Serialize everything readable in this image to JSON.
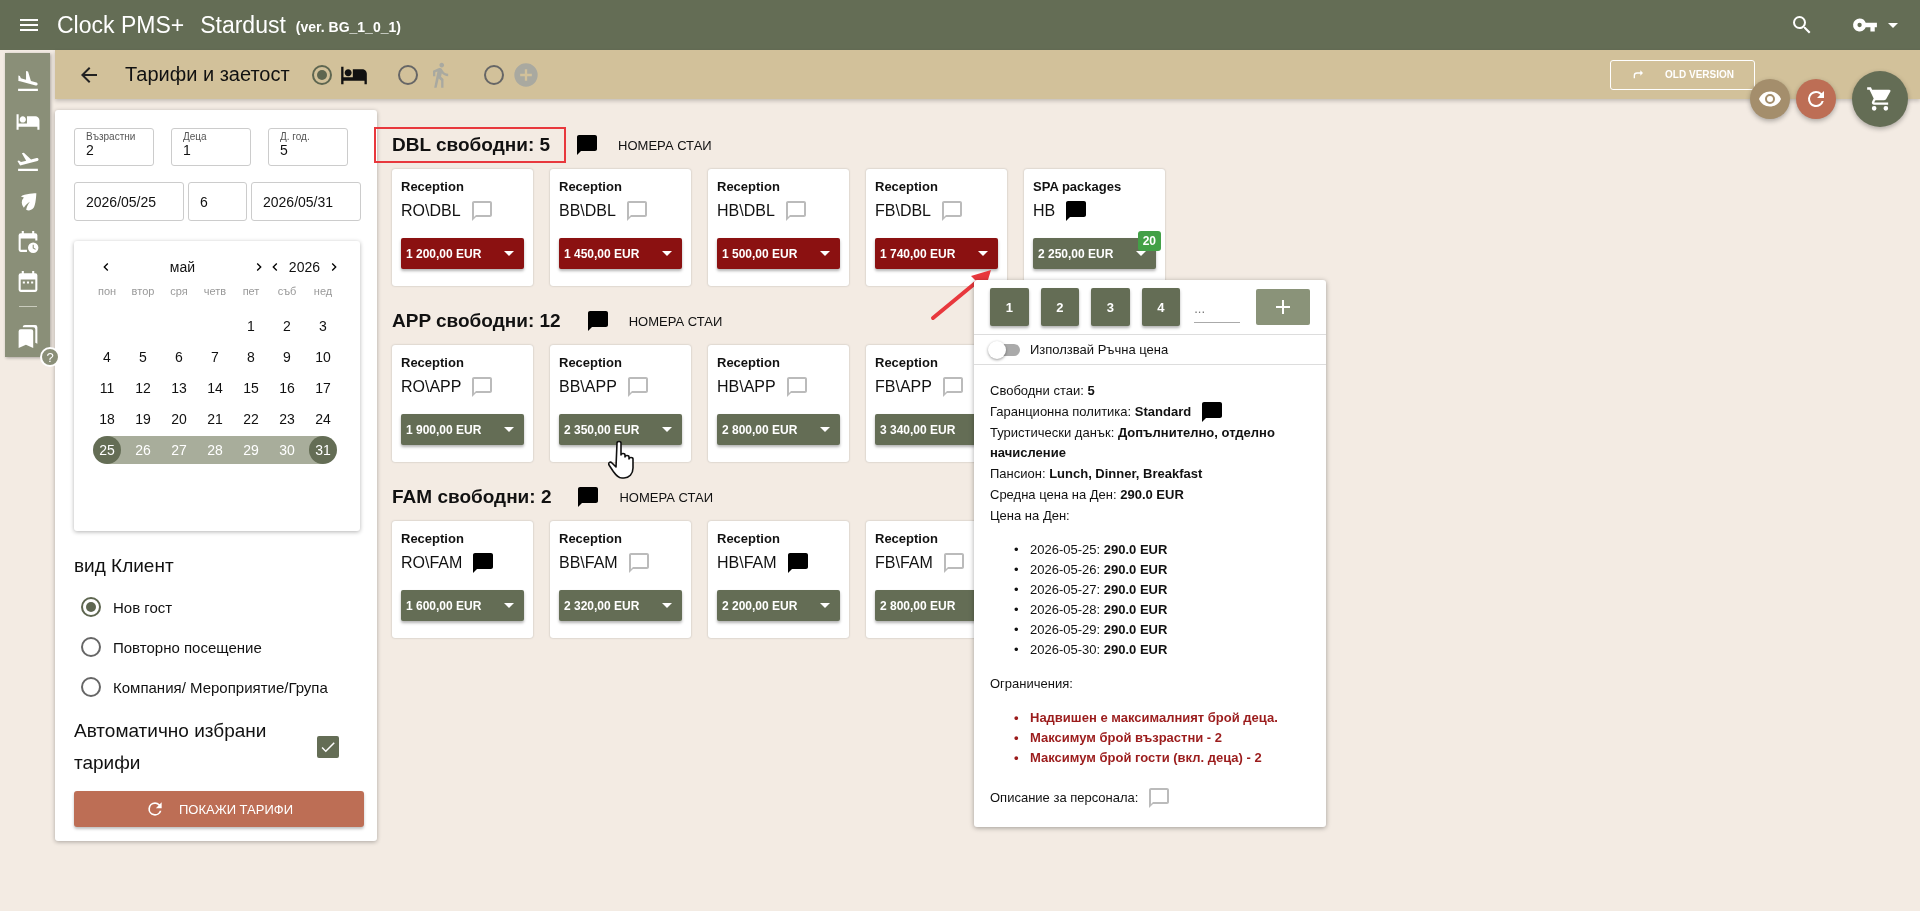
{
  "app_bar": {
    "title": "Clock PMS+",
    "hotel": "Stardust",
    "version": "(ver. BG_1_0_1)"
  },
  "toolbar": {
    "title": "Тарифи и заетост",
    "modes": [
      {
        "kind": "bed",
        "selected": true
      },
      {
        "kind": "walk",
        "selected": false
      },
      {
        "kind": "add",
        "selected": false
      }
    ],
    "old_version": "OLD VERSION"
  },
  "side_rail": {
    "help": "?"
  },
  "search": {
    "fields": [
      {
        "label": "Възрастни",
        "value": "2"
      },
      {
        "label": "Деца",
        "value": "1"
      },
      {
        "label": "Д. год.",
        "value": "5"
      }
    ],
    "dates": [
      "2026/05/25",
      "6",
      "2026/05/31"
    ],
    "calendar": {
      "month": "май",
      "year": "2026",
      "weekdays": [
        "пон",
        "втор",
        "сря",
        "четв",
        "пет",
        "съб",
        "нед"
      ],
      "weeks": [
        [
          {
            "day": "1",
            "selected": false,
            "in_range": false
          },
          {
            "day": "2",
            "selected": false,
            "in_range": false
          },
          {
            "day": "3",
            "selected": false,
            "in_range": false
          }
        ],
        [
          {
            "day": "4",
            "selected": false,
            "in_range": false
          },
          {
            "day": "5",
            "selected": false,
            "in_range": false
          },
          {
            "day": "6",
            "selected": false,
            "in_range": false
          },
          {
            "day": "7",
            "selected": false,
            "in_range": false
          },
          {
            "day": "8",
            "selected": false,
            "in_range": false
          },
          {
            "day": "9",
            "selected": false,
            "in_range": false
          },
          {
            "day": "10",
            "selected": false,
            "in_range": false
          }
        ],
        [
          {
            "day": "11",
            "selected": false,
            "in_range": false
          },
          {
            "day": "12",
            "selected": false,
            "in_range": false
          },
          {
            "day": "13",
            "selected": false,
            "in_range": false
          },
          {
            "day": "14",
            "selected": false,
            "in_range": false
          },
          {
            "day": "15",
            "selected": false,
            "in_range": false
          },
          {
            "day": "16",
            "selected": false,
            "in_range": false
          },
          {
            "day": "17",
            "selected": false,
            "in_range": false
          }
        ],
        [
          {
            "day": "18",
            "selected": false,
            "in_range": false
          },
          {
            "day": "19",
            "selected": false,
            "in_range": false
          },
          {
            "day": "20",
            "selected": false,
            "in_range": false
          },
          {
            "day": "21",
            "selected": false,
            "in_range": false
          },
          {
            "day": "22",
            "selected": false,
            "in_range": false
          },
          {
            "day": "23",
            "selected": false,
            "in_range": false
          },
          {
            "day": "24",
            "selected": false,
            "in_range": false
          }
        ],
        [
          {
            "day": "25",
            "selected": true,
            "in_range": true
          },
          {
            "day": "26",
            "selected": false,
            "in_range": true
          },
          {
            "day": "27",
            "selected": false,
            "in_range": true
          },
          {
            "day": "28",
            "selected": false,
            "in_range": true
          },
          {
            "day": "29",
            "selected": false,
            "in_range": true
          },
          {
            "day": "30",
            "selected": false,
            "in_range": true
          },
          {
            "day": "31",
            "selected": true,
            "in_range": true
          }
        ]
      ]
    },
    "client_type": {
      "title": "вид Клиент",
      "options": [
        {
          "label": "Нов гост",
          "selected": true
        },
        {
          "label": "Повторно посещение",
          "selected": false
        },
        {
          "label": "Компания/ Мероприятие/Група",
          "selected": false
        }
      ]
    },
    "auto_rates": {
      "label": "Автоматично избрани тарифи",
      "checked": true
    },
    "show_button": "ПОКАЖИ ТАРИФИ"
  },
  "room_types": [
    {
      "title": "DBL свободни: 5",
      "highlighted": true,
      "has_note": true,
      "rooms_link": "НОМЕРА СТАИ",
      "rates": [
        {
          "source": "Reception",
          "name": "RO\\DBL",
          "has_note": false,
          "price": "1 200,00 EUR",
          "restricted": true
        },
        {
          "source": "Reception",
          "name": "BB\\DBL",
          "has_note": false,
          "price": "1 450,00 EUR",
          "restricted": true
        },
        {
          "source": "Reception",
          "name": "HB\\DBL",
          "has_note": false,
          "price": "1 500,00 EUR",
          "restricted": true
        },
        {
          "source": "Reception",
          "name": "FB\\DBL",
          "has_note": false,
          "price": "1 740,00 EUR",
          "restricted": true
        },
        {
          "source": "SPA packages",
          "name": "HB",
          "has_note": true,
          "price": "2 250,00 EUR",
          "restricted": false,
          "badge": "20"
        }
      ]
    },
    {
      "title": "APP свободни: 12",
      "highlighted": false,
      "has_note": true,
      "rooms_link": "НОМЕРА СТАИ",
      "rates": [
        {
          "source": "Reception",
          "name": "RO\\APP",
          "has_note": false,
          "price": "1 900,00 EUR",
          "restricted": false
        },
        {
          "source": "Reception",
          "name": "BB\\APP",
          "has_note": false,
          "price": "2 350,00 EUR",
          "restricted": false
        },
        {
          "source": "Reception",
          "name": "HB\\APP",
          "has_note": false,
          "price": "2 800,00 EUR",
          "restricted": false
        },
        {
          "source": "Reception",
          "name": "FB\\APP",
          "has_note": false,
          "price": "3 340,00 EUR",
          "restricted": false
        }
      ]
    },
    {
      "title": "FAM свободни: 2",
      "highlighted": false,
      "has_note": true,
      "rooms_link": "НОМЕРА СТАИ",
      "rates": [
        {
          "source": "Reception",
          "name": "RO\\FAM",
          "has_note": true,
          "price": "1 600,00 EUR",
          "restricted": false
        },
        {
          "source": "Reception",
          "name": "BB\\FAM",
          "has_note": false,
          "price": "2 320,00 EUR",
          "restricted": false
        },
        {
          "source": "Reception",
          "name": "HB\\FAM",
          "has_note": true,
          "price": "2 200,00 EUR",
          "restricted": false
        },
        {
          "source": "Reception",
          "name": "FB\\FAM",
          "has_note": false,
          "price": "2 800,00 EUR",
          "restricted": false
        }
      ]
    }
  ],
  "rate_popup": {
    "quantities": [
      "1",
      "2",
      "3",
      "4"
    ],
    "quantity_placeholder": "...",
    "manual_price": {
      "label": "Използвай Ръчна цена",
      "on": false
    },
    "details": [
      {
        "text": "Свободни стаи: **5**",
        "has_note": false
      },
      {
        "text": "Гаранционна политика: **Standard**",
        "has_note": true
      },
      {
        "text": "Туристически данък: **Допълнително, отделно начисление**",
        "has_note": false
      },
      {
        "text": "Пансион: **Lunch, Dinner, Breakfast**",
        "has_note": false
      },
      {
        "text": "Средна цена на Ден: **290.0 EUR**",
        "has_note": false
      },
      {
        "text": "Цена на Ден:",
        "has_note": false
      }
    ],
    "daily_prices": [
      {
        "marker": "•",
        "text": "2026-05-25: **290.0 EUR**"
      },
      {
        "marker": "•",
        "text": "2026-05-26: **290.0 EUR**"
      },
      {
        "marker": "•",
        "text": "2026-05-27: **290.0 EUR**"
      },
      {
        "marker": "•",
        "text": "2026-05-28: **290.0 EUR**"
      },
      {
        "marker": "•",
        "text": "2026-05-29: **290.0 EUR**"
      },
      {
        "marker": "•",
        "text": "2026-05-30: **290.0 EUR**"
      }
    ],
    "restrictions_title": "Ограничения:",
    "restrictions": [
      {
        "marker": "•",
        "text": "Надвишен е максималният брой деца."
      },
      {
        "marker": "•",
        "text": "Максимум брой възрастни - 2"
      },
      {
        "marker": "•",
        "text": "Максимум брой гости (вкл. деца) - 2"
      }
    ],
    "staff_description": {
      "label": "Описание за персонала:",
      "has_note": false
    }
  }
}
